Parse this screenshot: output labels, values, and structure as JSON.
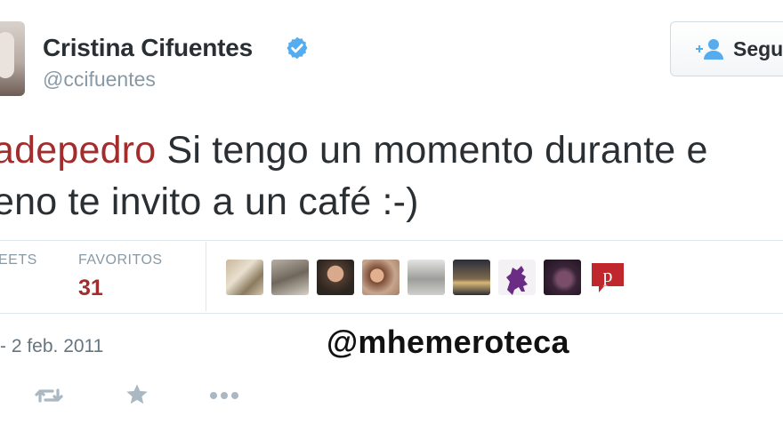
{
  "user": {
    "name": "Cristina Cifuentes",
    "handle": "@ccifuentes",
    "verified": true
  },
  "follow_button": {
    "label": "Segu",
    "icon": "add-user-icon"
  },
  "tweet": {
    "mention": "adepedro",
    "text_line1": " Si tengo un momento durante e",
    "text_line2": "eno te invito a un café :-)"
  },
  "stats": {
    "retweets_label": "EETS",
    "favorites_label": "FAVORITOS",
    "favorites_count": "31"
  },
  "favoriters": [
    {
      "icon": "favoriter-avatar-1"
    },
    {
      "icon": "favoriter-avatar-2"
    },
    {
      "icon": "favoriter-avatar-3"
    },
    {
      "icon": "favoriter-avatar-4"
    },
    {
      "icon": "favoriter-avatar-5"
    },
    {
      "icon": "favoriter-avatar-6"
    },
    {
      "icon": "favoriter-avatar-7"
    },
    {
      "icon": "favoriter-avatar-8"
    },
    {
      "icon": "favoriter-avatar-9"
    }
  ],
  "timestamp": "- 2 feb. 2011",
  "watermark": "@mhemeroteca",
  "actions": [
    {
      "icon": "retweet-icon"
    },
    {
      "icon": "favorite-star-icon"
    },
    {
      "icon": "more-dots-icon"
    }
  ],
  "colors": {
    "mention": "#a32d2d",
    "verified": "#55acee",
    "muted": "#8899a6"
  }
}
